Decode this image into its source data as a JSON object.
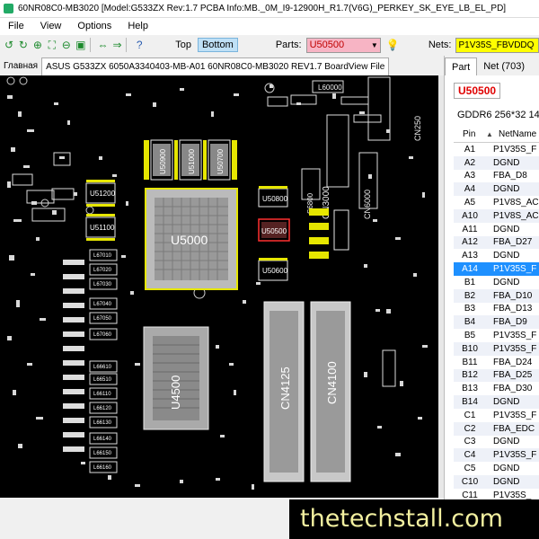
{
  "window": {
    "title": "60NR08C0-MB3020 [Model:G533ZX Rev:1.7 PCBA Info:MB._0M_I9-12900H_R1.7(V6G)_PERKEY_SK_EYE_LB_EL_PD]"
  },
  "menu": [
    "File",
    "View",
    "Options",
    "Help"
  ],
  "toolbar": {
    "top_label": "Top",
    "bottom_label": "Bottom",
    "parts_label": "Parts:",
    "parts_value": "U50500",
    "nets_label": "Nets:",
    "nets_value": "P1V35S_FBVDDQ"
  },
  "doc_tabs": [
    "Главная",
    "ASUS G533ZX 6050A3340403-MB-A01 60NR08C0-MB3020 REV1.7 BoardView File"
  ],
  "panel": {
    "tabs": [
      "Part",
      "Net (703)"
    ],
    "part_name": "U50500",
    "part_desc": "GDDR6 256*32 14 1.",
    "col_pin": "Pin",
    "col_net": "NetName",
    "rows": [
      {
        "pin": "A1",
        "net": "P1V35S_F"
      },
      {
        "pin": "A2",
        "net": "DGND"
      },
      {
        "pin": "A3",
        "net": "FBA_D8"
      },
      {
        "pin": "A4",
        "net": "DGND"
      },
      {
        "pin": "A5",
        "net": "P1V8S_AC"
      },
      {
        "pin": "A10",
        "net": "P1V8S_AC"
      },
      {
        "pin": "A11",
        "net": "DGND"
      },
      {
        "pin": "A12",
        "net": "FBA_D27"
      },
      {
        "pin": "A13",
        "net": "DGND"
      },
      {
        "pin": "A14",
        "net": "P1V35S_F"
      },
      {
        "pin": "B1",
        "net": "DGND"
      },
      {
        "pin": "B2",
        "net": "FBA_D10"
      },
      {
        "pin": "B3",
        "net": "FBA_D13"
      },
      {
        "pin": "B4",
        "net": "FBA_D9"
      },
      {
        "pin": "B5",
        "net": "P1V35S_F"
      },
      {
        "pin": "B10",
        "net": "P1V35S_F"
      },
      {
        "pin": "B11",
        "net": "FBA_D24"
      },
      {
        "pin": "B12",
        "net": "FBA_D25"
      },
      {
        "pin": "B13",
        "net": "FBA_D30"
      },
      {
        "pin": "B14",
        "net": "DGND"
      },
      {
        "pin": "C1",
        "net": "P1V35S_F"
      },
      {
        "pin": "C2",
        "net": "FBA_EDC"
      },
      {
        "pin": "C3",
        "net": "DGND"
      },
      {
        "pin": "C4",
        "net": "P1V35S_F"
      },
      {
        "pin": "C5",
        "net": "DGND"
      },
      {
        "pin": "C10",
        "net": "DGND"
      },
      {
        "pin": "C11",
        "net": "P1V35S_"
      }
    ],
    "selected_index": 9
  },
  "board": {
    "labels": {
      "u5000": "U5000",
      "u4500": "U4500",
      "cn4125": "CN4125",
      "cn4100": "CN4100",
      "cn3000": "CN3000",
      "cn250": "CN250",
      "cn6000": "CN6000",
      "u50500": "U50500",
      "u50800": "U50800",
      "u50600": "U50600",
      "u51200": "U51200",
      "u51100": "U51100",
      "u50900": "U50900",
      "u51000": "U51000",
      "u50700": "U50700",
      "u50400": "U50400",
      "u60000": "L60000",
      "s6800": "S6800"
    },
    "inductors": [
      "L67010",
      "L67020",
      "L67030",
      "L67040",
      "L67050",
      "L67060",
      "L66610",
      "L66510",
      "L66110",
      "L66120",
      "L66130",
      "L66140",
      "L66150",
      "L66160"
    ]
  },
  "watermark": "thetechstall.com"
}
